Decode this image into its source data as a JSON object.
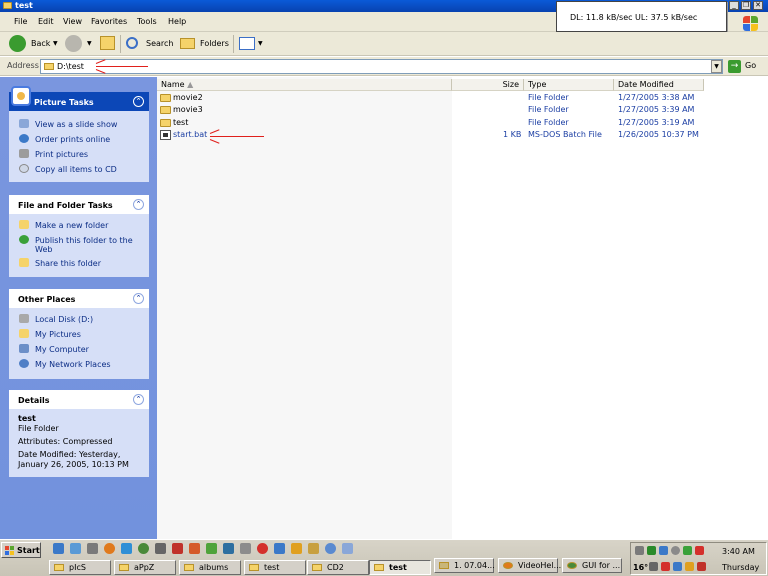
{
  "window": {
    "title": "test"
  },
  "speed": {
    "text": "DL: 11.8 kB/sec  UL: 37.5 kB/sec"
  },
  "menu": [
    "File",
    "Edit",
    "View",
    "Favorites",
    "Tools",
    "Help"
  ],
  "toolbar": {
    "back": "Back",
    "search": "Search",
    "folders": "Folders"
  },
  "address": {
    "label": "Address",
    "value": "D:\\test",
    "go": "Go"
  },
  "taskpane": {
    "picture_tasks": {
      "title": "Picture Tasks",
      "items": [
        "View as a slide show",
        "Order prints online",
        "Print pictures",
        "Copy all items to CD"
      ]
    },
    "file_folder_tasks": {
      "title": "File and Folder Tasks",
      "items": [
        "Make a new folder",
        "Publish this folder to the",
        "Web",
        "Share this folder"
      ]
    },
    "other_places": {
      "title": "Other Places",
      "items": [
        "Local Disk (D:)",
        "My Pictures",
        "My Computer",
        "My Network Places"
      ]
    },
    "details": {
      "title": "Details",
      "name": "test",
      "type": "File Folder",
      "attributes": "Attributes: Compressed",
      "date_line1": "Date Modified: Yesterday,",
      "date_line2": "January 26, 2005, 10:13 PM"
    }
  },
  "columns": {
    "name": "Name",
    "size": "Size",
    "type": "Type",
    "date": "Date Modified"
  },
  "files": [
    {
      "name": "movie2",
      "size": "",
      "type": "File Folder",
      "date": "1/27/2005 3:38 AM"
    },
    {
      "name": "movie3",
      "size": "",
      "type": "File Folder",
      "date": "1/27/2005 3:39 AM"
    },
    {
      "name": "test",
      "size": "",
      "type": "File Folder",
      "date": "1/27/2005 3:19 AM"
    },
    {
      "name": "start.bat",
      "size": "1 KB",
      "type": "MS-DOS Batch File",
      "date": "1/26/2005 10:37 PM"
    }
  ],
  "taskbar": {
    "start": "Start",
    "buttons_row1": [
      "1. 07.04...",
      "VideoHel...",
      "GUI for ..."
    ],
    "buttons_row2": [
      "pIcS",
      "aPpZ",
      "albums",
      "test",
      "CD2",
      "test"
    ],
    "clock": "3:40 AM",
    "day": "Thursday",
    "temp": "16°"
  },
  "colors": {
    "titlebar": "#0a5ad8",
    "taskpane": "#7a96df",
    "arrow": "#e0201c"
  }
}
